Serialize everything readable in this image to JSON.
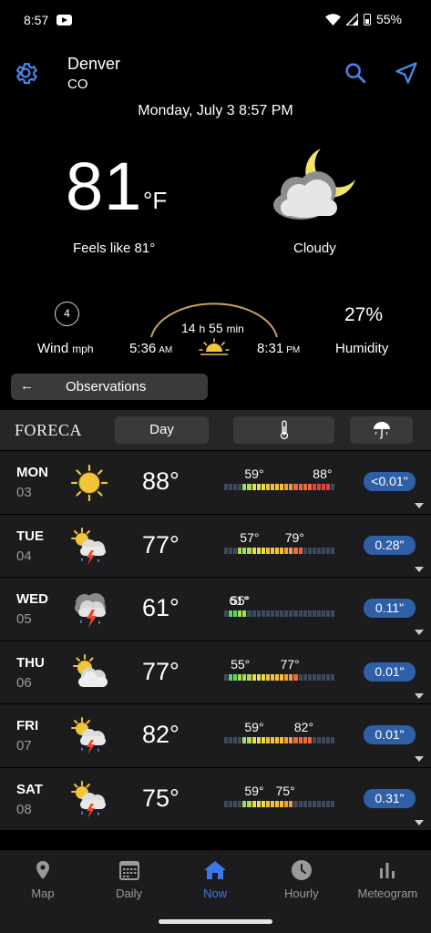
{
  "status": {
    "time": "8:57",
    "battery": "55%"
  },
  "location": {
    "city": "Denver",
    "region": "CO"
  },
  "datetime": "Monday, July 3 8:57 PM",
  "current": {
    "temperature": "81",
    "unit": "°F",
    "feels_like": "Feels like 81°",
    "condition": "Cloudy",
    "condition_icon": "partly-cloudy-night-icon"
  },
  "details": {
    "wind_speed": "4",
    "wind_label": "Wind",
    "wind_unit": "mph",
    "day_length_hours": "14",
    "day_length_h": "h",
    "day_length_min": "55",
    "day_length_min_label": "min",
    "sunrise": "5:36",
    "sunrise_ampm": "AM",
    "sunset": "8:31",
    "sunset_ampm": "PM",
    "humidity": "27%",
    "humidity_label": "Humidity"
  },
  "observations": {
    "label": "Observations"
  },
  "forecast_header": {
    "brand": "FORECA",
    "tab_day": "Day"
  },
  "daily": [
    {
      "day": "MON",
      "date": "03",
      "icon": "sunny-icon",
      "high": "88°",
      "low_label": "59°",
      "high_label": "88°",
      "low_val": 59,
      "high_val": 88,
      "precip": "<0.01\""
    },
    {
      "day": "TUE",
      "date": "04",
      "icon": "sun-thunder-rain-icon",
      "high": "77°",
      "low_label": "57°",
      "high_label": "79°",
      "low_val": 57,
      "high_val": 79,
      "precip": "0.28\""
    },
    {
      "day": "WED",
      "date": "05",
      "icon": "cloud-thunder-rain-icon",
      "high": "61°",
      "low_label": "55°",
      "high_label": "61°",
      "low_val": 55,
      "high_val": 61,
      "precip": "0.11\""
    },
    {
      "day": "THU",
      "date": "06",
      "icon": "partly-cloudy-icon",
      "high": "77°",
      "low_label": "55°",
      "high_label": "77°",
      "low_val": 55,
      "high_val": 77,
      "precip": "0.01\""
    },
    {
      "day": "FRI",
      "date": "07",
      "icon": "sun-thunder-rain-icon",
      "high": "82°",
      "low_label": "59°",
      "high_label": "82°",
      "low_val": 59,
      "high_val": 82,
      "precip": "0.01\""
    },
    {
      "day": "SAT",
      "date": "08",
      "icon": "sun-thunder-rain-icon",
      "high": "75°",
      "low_label": "59°",
      "high_label": "75°",
      "low_val": 59,
      "high_val": 75,
      "precip": "0.31\""
    }
  ],
  "nav": [
    {
      "label": "Map",
      "icon": "map-pin-icon",
      "active": false
    },
    {
      "label": "Daily",
      "icon": "calendar-icon",
      "active": false
    },
    {
      "label": "Now",
      "icon": "home-icon",
      "active": true
    },
    {
      "label": "Hourly",
      "icon": "clock-icon",
      "active": false
    },
    {
      "label": "Meteogram",
      "icon": "bar-chart-icon",
      "active": false
    }
  ],
  "colors": {
    "accent": "#3b78e7",
    "precip_pill": "#2f5fa6",
    "row_bg": "#1c1c1e"
  }
}
